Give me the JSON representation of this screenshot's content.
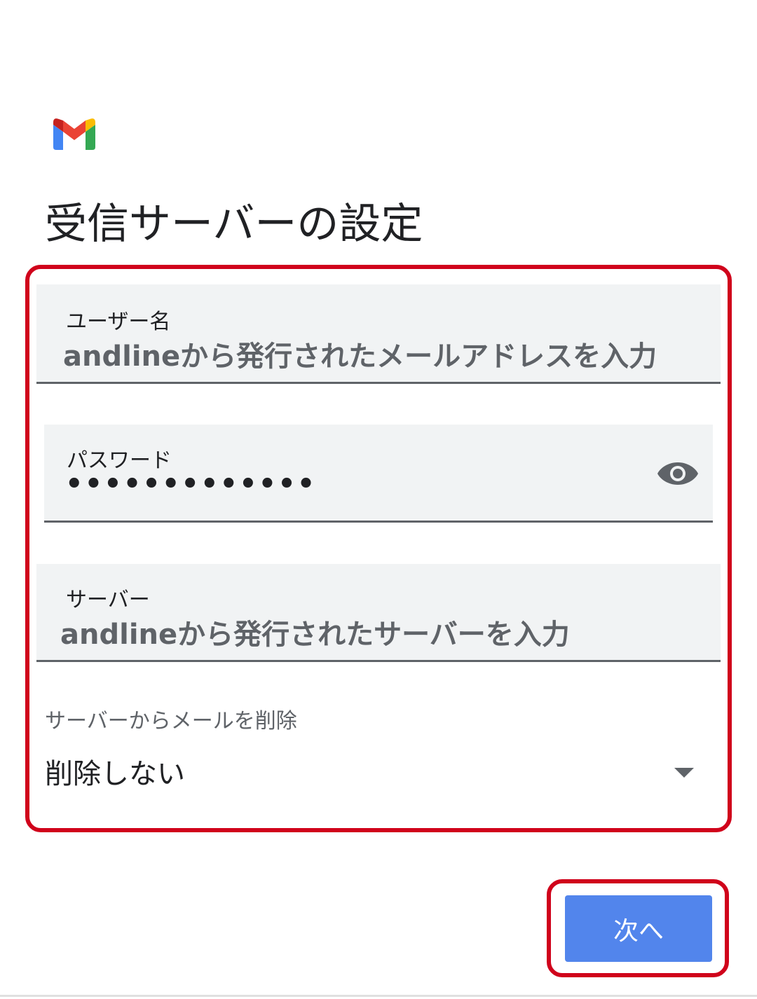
{
  "app": {
    "logo_icon": "gmail-logo-icon"
  },
  "page": {
    "title": "受信サーバーの設定"
  },
  "form": {
    "username": {
      "label": "ユーザー名",
      "value": "andlineから発行されたメールアドレスを入力"
    },
    "password": {
      "label": "パスワード",
      "value": "•••••••••••••",
      "toggle_icon": "eye-icon"
    },
    "server": {
      "label": "サーバー",
      "value": "andlineから発行されたサーバーを入力"
    },
    "delete_from_server": {
      "label": "サーバーからメールを削除",
      "selected": "削除しない",
      "icon": "dropdown-arrow-icon"
    }
  },
  "actions": {
    "next_label": "次へ"
  },
  "colors": {
    "highlight": "#d0021b",
    "button": "#5285ec",
    "field_bg": "#f1f3f4"
  }
}
